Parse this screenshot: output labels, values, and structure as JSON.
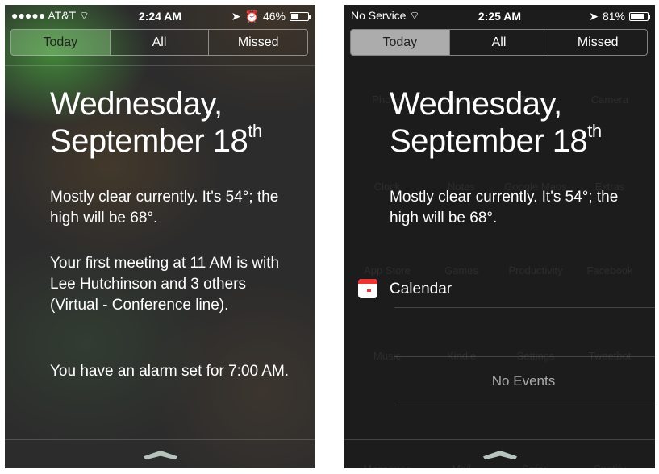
{
  "left": {
    "status": {
      "carrier": "●●●●● AT&T",
      "wifi_icon": "wifi-icon",
      "time": "2:24 AM",
      "location_icon": "location-arrow-icon",
      "alarm_icon": "alarm-clock-icon",
      "battery": "46%",
      "battery_level": 0.46
    },
    "tabs": [
      {
        "label": "Today",
        "selected": true
      },
      {
        "label": "All"
      },
      {
        "label": "Missed"
      }
    ],
    "date_line1": "Wednesday,",
    "date_line2": "September 18",
    "date_suffix": "th",
    "weather": "Mostly clear currently. It's 54°; the high will be 68°.",
    "meeting": "Your first meeting at 11 AM is with Lee Hutchinson and 3 others (Virtual - Conference line).",
    "alarm": "You have an alarm set for 7:00 AM."
  },
  "right": {
    "status": {
      "carrier": "No Service",
      "wifi_icon": "wifi-icon",
      "time": "2:25 AM",
      "location_icon": "location-arrow-icon",
      "battery": "81%",
      "battery_level": 0.81
    },
    "tabs": [
      {
        "label": "Today",
        "selected": true
      },
      {
        "label": "All"
      },
      {
        "label": "Missed"
      }
    ],
    "date_line1": "Wednesday,",
    "date_line2": "September 18",
    "date_suffix": "th",
    "weather": "Mostly clear currently. It's 54°; the high will be 68°.",
    "calendar_title": "Calendar",
    "no_events": "No Events",
    "background_apps": [
      "Phone",
      "Calendar",
      "Photos",
      "Camera",
      "Clock",
      "Notes",
      "Google Maps",
      "Extras",
      "App Store",
      "Games",
      "Productivity",
      "Facebook",
      "Music",
      "Kindle",
      "Settings",
      "Tweetbot",
      "Messages",
      "Mail",
      "Safari",
      "Spotify"
    ]
  }
}
